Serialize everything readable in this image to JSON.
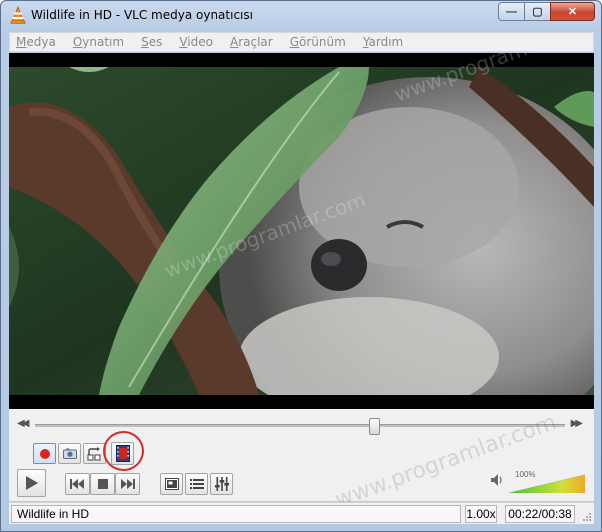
{
  "window": {
    "title": "Wildlife in HD - VLC medya oynatıcısı",
    "minimize_glyph": "—",
    "maximize_glyph": "▢",
    "close_glyph": "✕"
  },
  "menu": {
    "items": [
      "Medya",
      "Oynatım",
      "Ses",
      "Video",
      "Araçlar",
      "Görünüm",
      "Yardım"
    ]
  },
  "watermark": "www.programlar.com",
  "controls": {
    "seek_position_fraction": 0.64,
    "buttons_row1": [
      "record-icon",
      "snapshot-icon",
      "loop-ab-icon",
      "frame-by-frame-icon"
    ],
    "buttons_row2": [
      "play-icon",
      "previous-icon",
      "stop-icon",
      "next-icon",
      "fullscreen-icon",
      "playlist-icon",
      "extended-settings-icon"
    ],
    "volume": {
      "percent_label": "100%",
      "level_fraction": 1.0
    }
  },
  "status": {
    "title": "Wildlife in HD",
    "speed": "1.00x",
    "time": "00:22/00:38"
  },
  "colors": {
    "accent": "#d22b2b",
    "record": "#e0241b",
    "volume_low": "#47c33a",
    "volume_high": "#f0a92a"
  }
}
